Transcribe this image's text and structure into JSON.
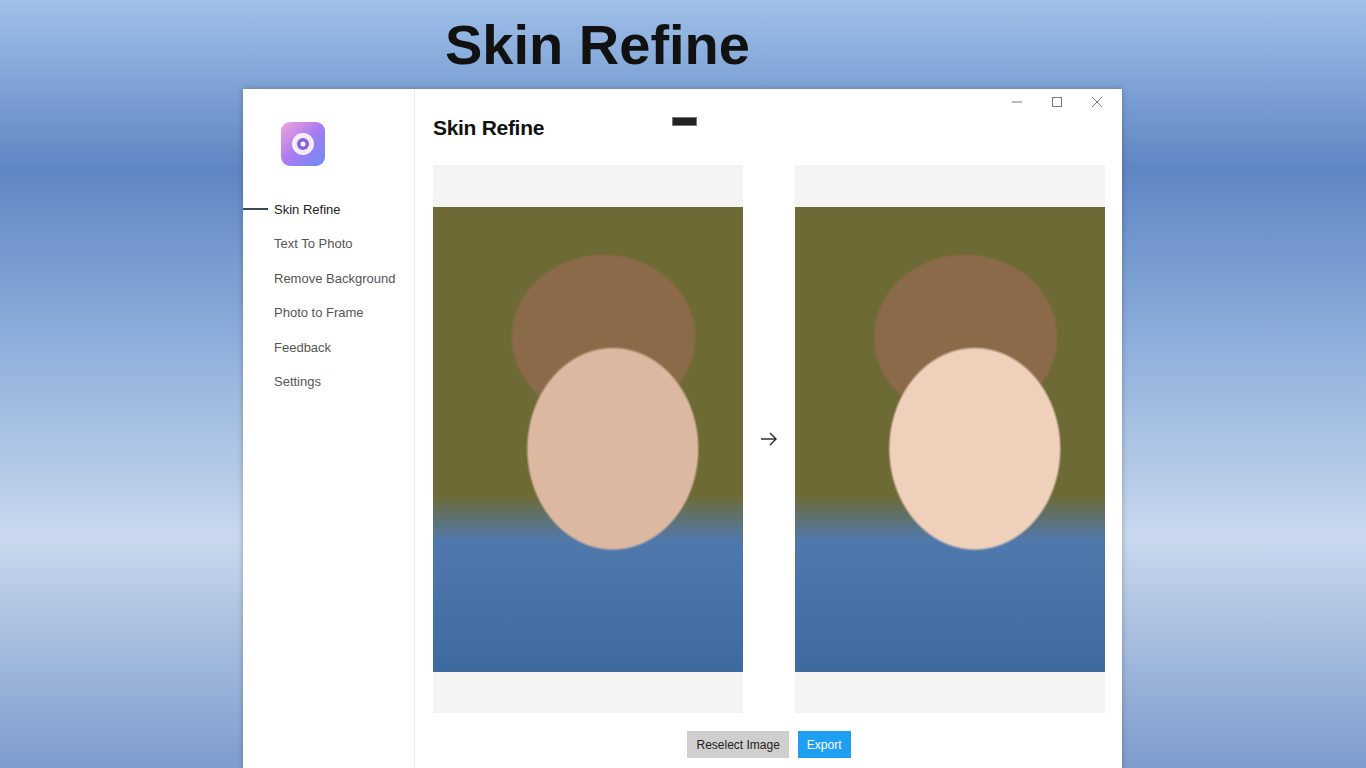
{
  "banner": {
    "title": "Skin Refine"
  },
  "sidebar": {
    "items": [
      {
        "label": "Skin Refine",
        "selected": true
      },
      {
        "label": "Text To Photo",
        "selected": false
      },
      {
        "label": "Remove Background",
        "selected": false
      },
      {
        "label": "Photo to Frame",
        "selected": false
      },
      {
        "label": "Feedback",
        "selected": false
      },
      {
        "label": "Settings",
        "selected": false
      }
    ]
  },
  "page": {
    "title": "Skin Refine"
  },
  "images": [
    {
      "kind": "original"
    },
    {
      "kind": "refined"
    }
  ],
  "buttons": [
    {
      "label": "Reselect Image",
      "kind": "secondary"
    },
    {
      "label": "Export",
      "kind": "primary"
    }
  ]
}
